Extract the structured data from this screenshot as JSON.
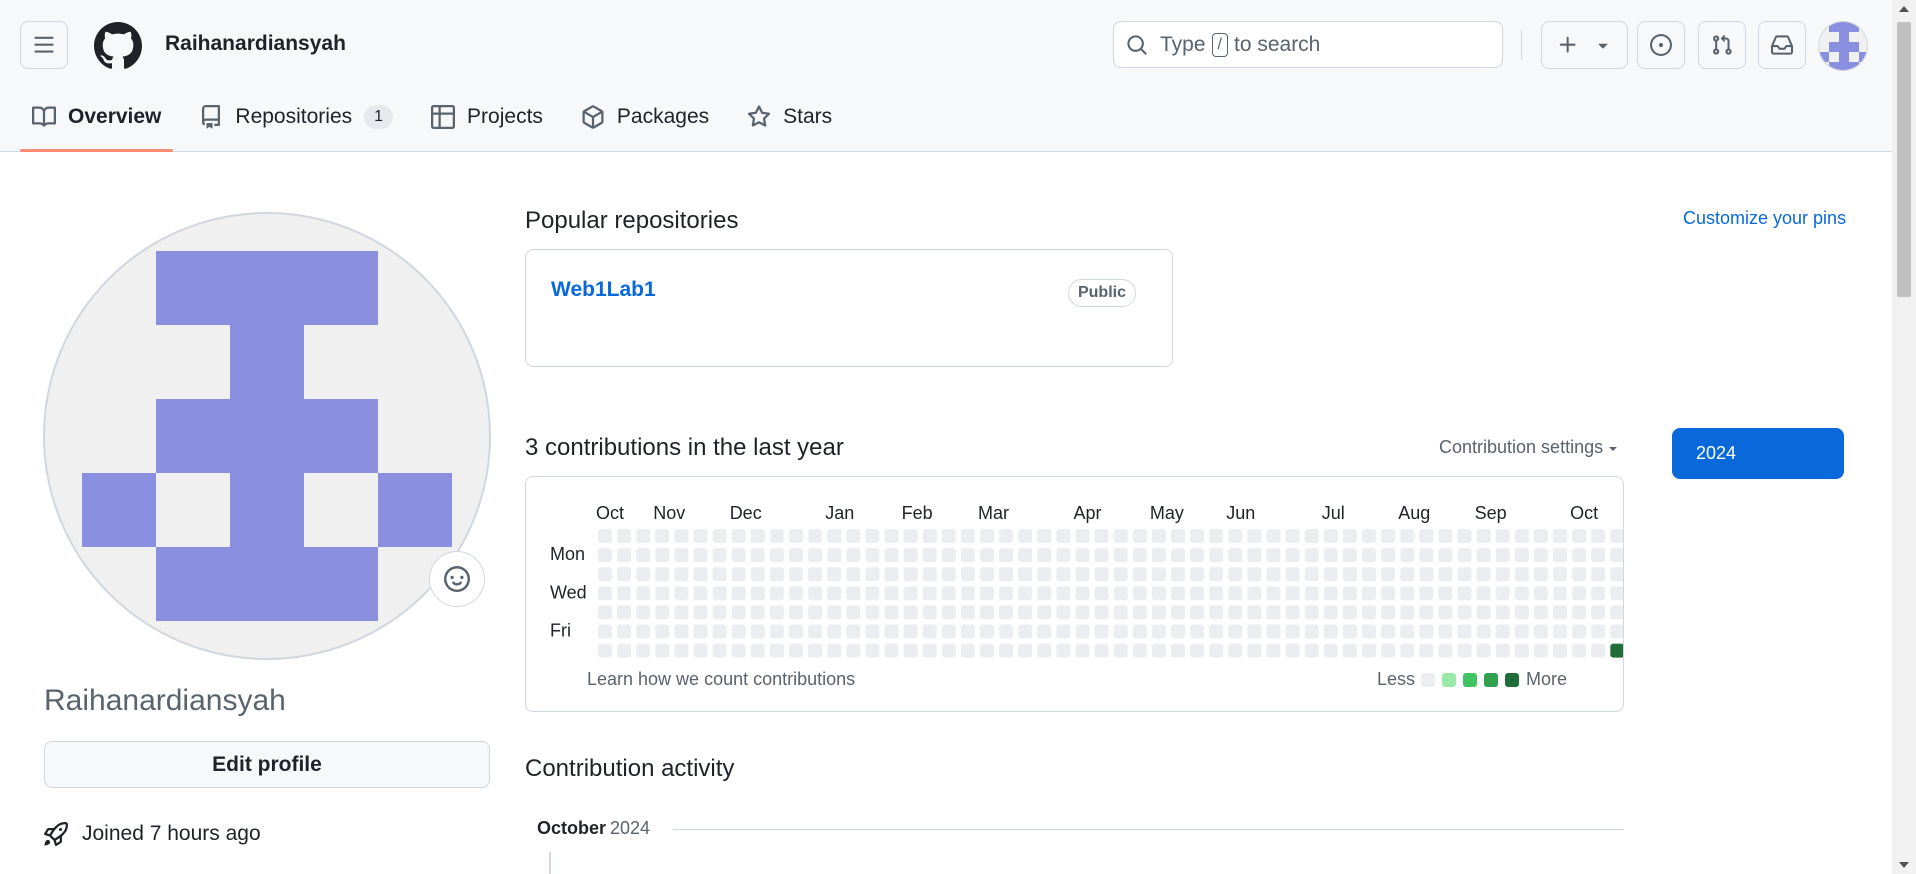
{
  "header": {
    "username": "Raihanardiansyah",
    "search_prefix": "Type",
    "search_key": "/",
    "search_suffix": "to search"
  },
  "tabs": [
    {
      "label": "Overview",
      "active": true
    },
    {
      "label": "Repositories",
      "count": "1"
    },
    {
      "label": "Projects"
    },
    {
      "label": "Packages"
    },
    {
      "label": "Stars"
    }
  ],
  "sidebar": {
    "display_name": "Raihanardiansyah",
    "edit_button": "Edit profile",
    "joined": "Joined 7 hours ago"
  },
  "popular": {
    "title": "Popular repositories",
    "customize": "Customize your pins",
    "repos": [
      {
        "name": "Web1Lab1",
        "visibility": "Public"
      }
    ]
  },
  "contributions": {
    "title": "3 contributions in the last year",
    "settings": "Contribution settings",
    "year_button": "2024",
    "months": [
      "Oct",
      "Nov",
      "Dec",
      "Jan",
      "Feb",
      "Mar",
      "Apr",
      "May",
      "Jun",
      "Jul",
      "Aug",
      "Sep",
      "Oct"
    ],
    "days": [
      "Mon",
      "Wed",
      "Fri"
    ],
    "learn": "Learn how we count contributions",
    "less": "Less",
    "more": "More",
    "colors": {
      "empty": "#ebedf0",
      "l1": "#9be9a8",
      "l2": "#40c463",
      "l3": "#30a14e",
      "l4": "#216e39"
    },
    "active_cells": [
      {
        "week": 53,
        "day": 6,
        "level": 4
      }
    ]
  },
  "activity": {
    "title": "Contribution activity",
    "month": "October",
    "year": "2024"
  },
  "colors": {
    "accent": "#0969da",
    "tab_underline": "#fd8c73",
    "identicon": "#8a8fe0"
  }
}
